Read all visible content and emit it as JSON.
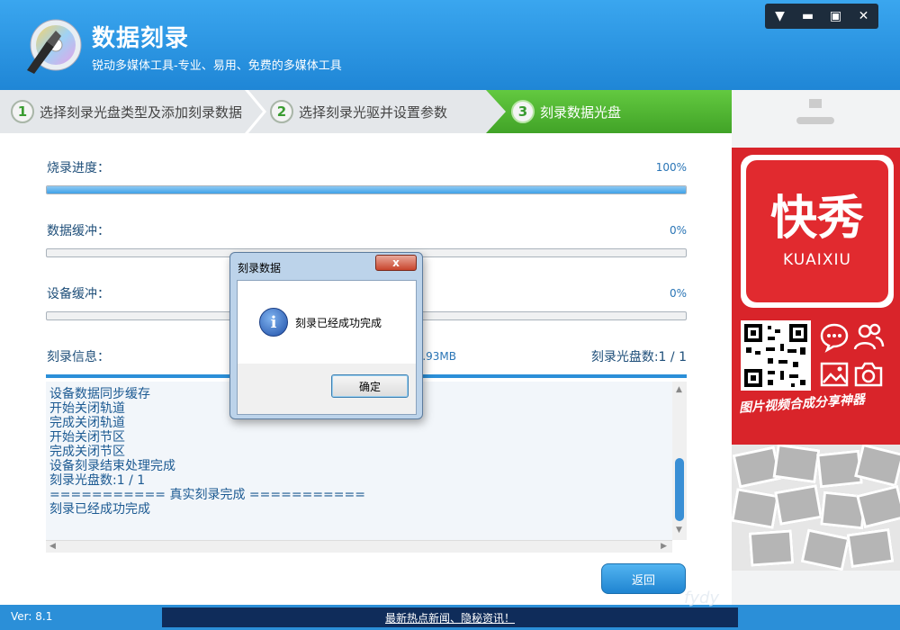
{
  "header": {
    "title": "数据刻录",
    "subtitle": "锐动多媒体工具-专业、易用、免费的多媒体工具"
  },
  "steps": [
    {
      "num": "1",
      "label": "选择刻录光盘类型及添加刻录数据"
    },
    {
      "num": "2",
      "label": "选择刻录光驱并设置参数"
    },
    {
      "num": "3",
      "label": "刻录数据光盘"
    }
  ],
  "progress": {
    "burn_label": "烧录进度：",
    "burn_value": "100%",
    "burn_fraction": 1.0,
    "data_label": "数据缓冲：",
    "data_value": "0%",
    "data_fraction": 0,
    "device_label": "设备缓冲：",
    "device_value": "0%",
    "device_fraction": 0
  },
  "info": {
    "label": "刻录信息：",
    "size_text": ".93MB",
    "disc_count": "刻录光盘数:1 / 1"
  },
  "log_text": "设备数据同步缓存\n开始关闭轨道\n完成关闭轨道\n开始关闭节区\n完成关闭节区\n设备刻录结束处理完成\n刻录光盘数:1 / 1\n=========== 真实刻录完成 ===========\n刻录已经成功完成",
  "back_label": "返回",
  "ad": {
    "big_text": "快秀",
    "small_text": "KUAIXIU",
    "slogan": "图片视频合成分享神器"
  },
  "footer": {
    "version": "Ver: 8.1",
    "news": "最新热点新闻、隐秘资讯！"
  },
  "dialog": {
    "title": "刻录数据",
    "close": "x",
    "message": "刻录已经成功完成",
    "ok": "确定"
  },
  "watermark": "fydy"
}
